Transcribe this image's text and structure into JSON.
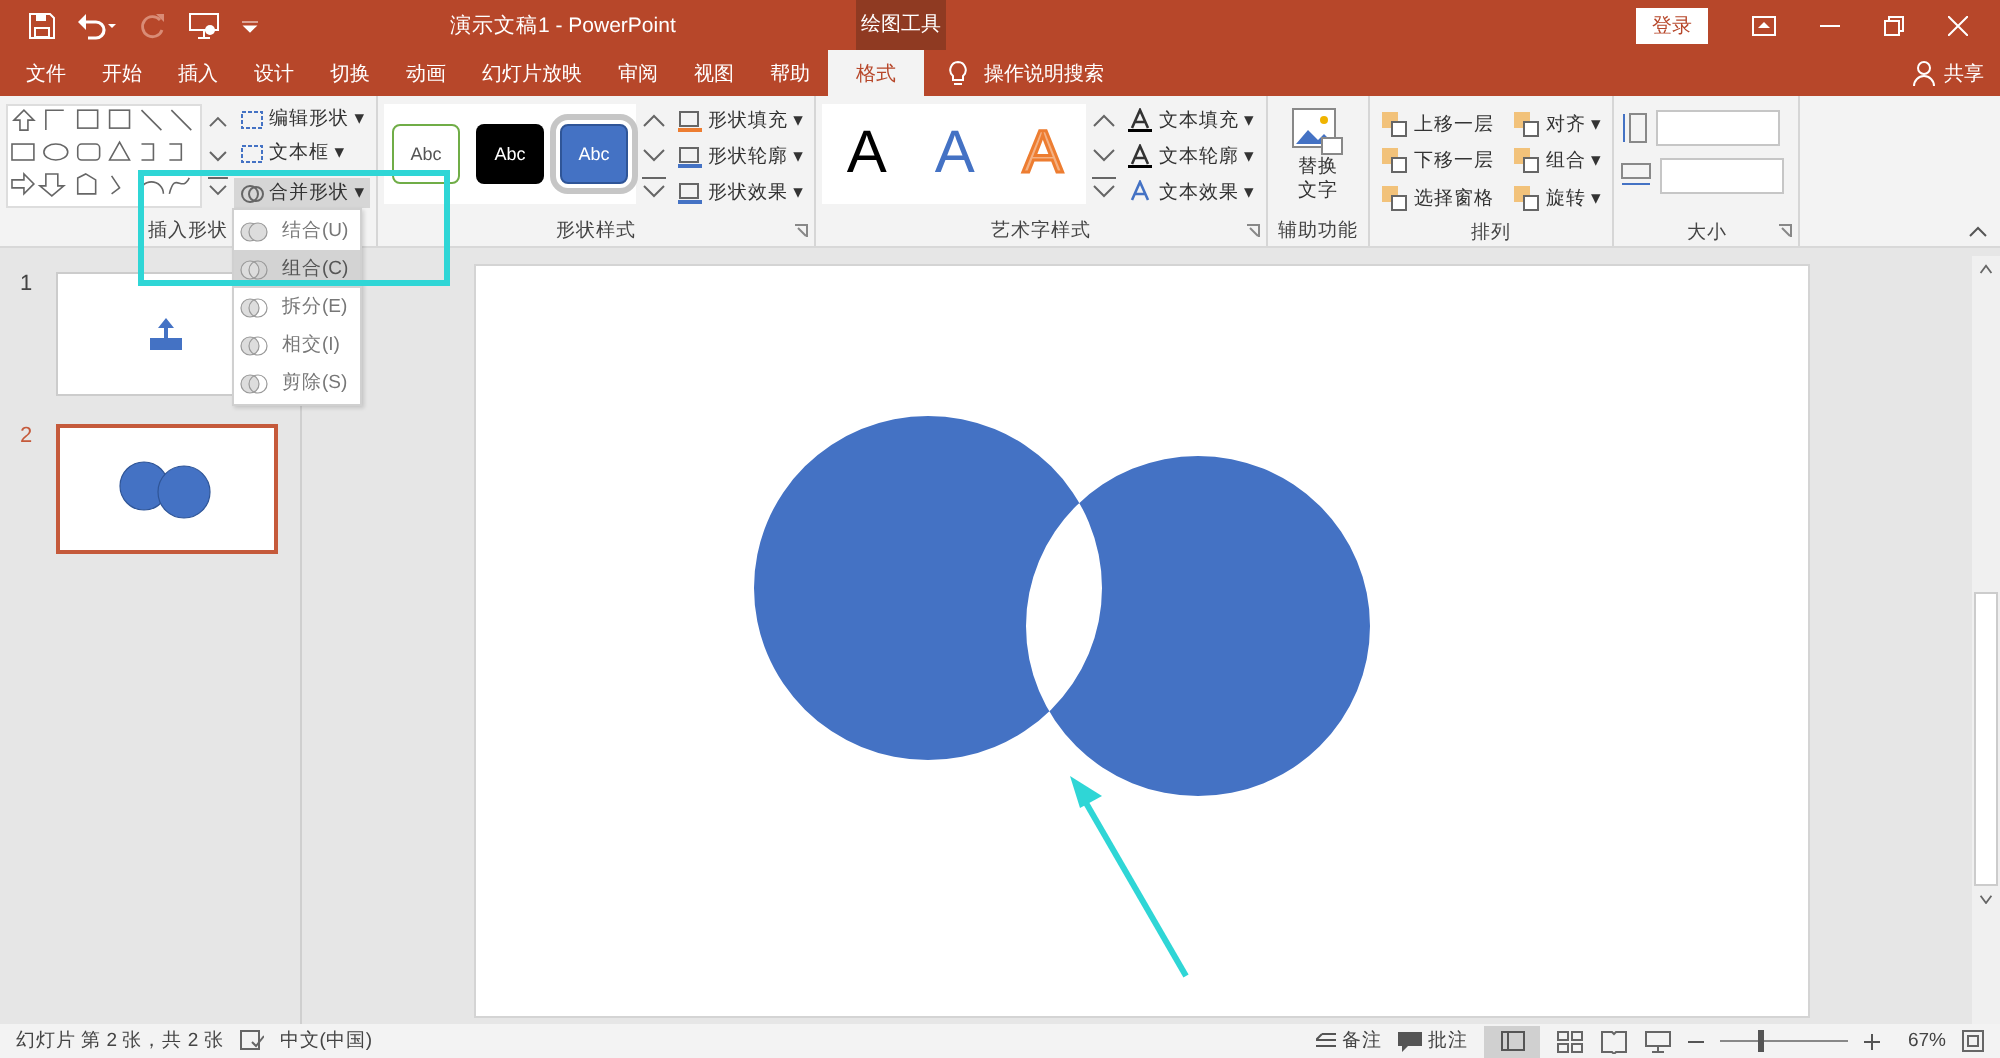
{
  "window": {
    "title": "演示文稿1  -  PowerPoint",
    "context_label": "绘图工具",
    "login": "登录"
  },
  "tabs": [
    {
      "label": "文件",
      "selected": false
    },
    {
      "label": "开始",
      "selected": false
    },
    {
      "label": "插入",
      "selected": false
    },
    {
      "label": "设计",
      "selected": false
    },
    {
      "label": "切换",
      "selected": false
    },
    {
      "label": "动画",
      "selected": false
    },
    {
      "label": "幻灯片放映",
      "selected": false
    },
    {
      "label": "审阅",
      "selected": false
    },
    {
      "label": "视图",
      "selected": false
    },
    {
      "label": "帮助",
      "selected": false
    },
    {
      "label": "格式",
      "selected": true
    }
  ],
  "tell_me": "操作说明搜索",
  "share": "共享",
  "insert_shapes": {
    "label": "插入形状",
    "commands": [
      {
        "label": "编辑形状 ▾"
      },
      {
        "label": "文本框 ▾"
      },
      {
        "label": "合并形状 ▾",
        "expanded": true
      }
    ]
  },
  "shape_styles": {
    "label": "形状样式",
    "presets": [
      {
        "text": "Abc",
        "kind": "outline",
        "selected": false
      },
      {
        "text": "Abc",
        "kind": "dark",
        "selected": false
      },
      {
        "text": "Abc",
        "kind": "blue",
        "selected": true
      }
    ],
    "commands": [
      {
        "label": "形状填充 ▾"
      },
      {
        "label": "形状轮廓 ▾"
      },
      {
        "label": "形状效果 ▾"
      }
    ]
  },
  "wordart": {
    "label": "艺术字样式",
    "presets": [
      {
        "text": "A",
        "kind": "black"
      },
      {
        "text": "A",
        "kind": "blue"
      },
      {
        "text": "A",
        "kind": "orange"
      }
    ],
    "commands": [
      {
        "label": "文本填充 ▾"
      },
      {
        "label": "文本轮廓 ▾"
      },
      {
        "label": "文本效果 ▾"
      }
    ]
  },
  "accessibility": {
    "label": "辅助功能",
    "button": "替换文字"
  },
  "arrange": {
    "label": "排列",
    "commands": [
      {
        "label": "上移一层"
      },
      {
        "label": "对齐 ▾"
      },
      {
        "label": "下移一层"
      },
      {
        "label": "组合 ▾"
      },
      {
        "label": "选择窗格"
      },
      {
        "label": "旋转 ▾"
      }
    ]
  },
  "size": {
    "label": "大小"
  },
  "merge_menu": [
    {
      "label": "结合(U)",
      "selected": false
    },
    {
      "label": "组合(C)",
      "selected": true
    },
    {
      "label": "拆分(E)",
      "selected": false
    },
    {
      "label": "相交(I)",
      "selected": false
    },
    {
      "label": "剪除(S)",
      "selected": false
    }
  ],
  "slides": [
    {
      "number": "1",
      "kind": "icon",
      "selected": false
    },
    {
      "number": "2",
      "kind": "circles",
      "selected": true
    }
  ],
  "status_bar": {
    "slide_info": "幻灯片 第 2 张，共 2 张",
    "language": "中文(中国)",
    "notes": "备注",
    "comments": "批注",
    "zoom": "67%",
    "zoom_slider": {
      "level": 0.3
    }
  }
}
